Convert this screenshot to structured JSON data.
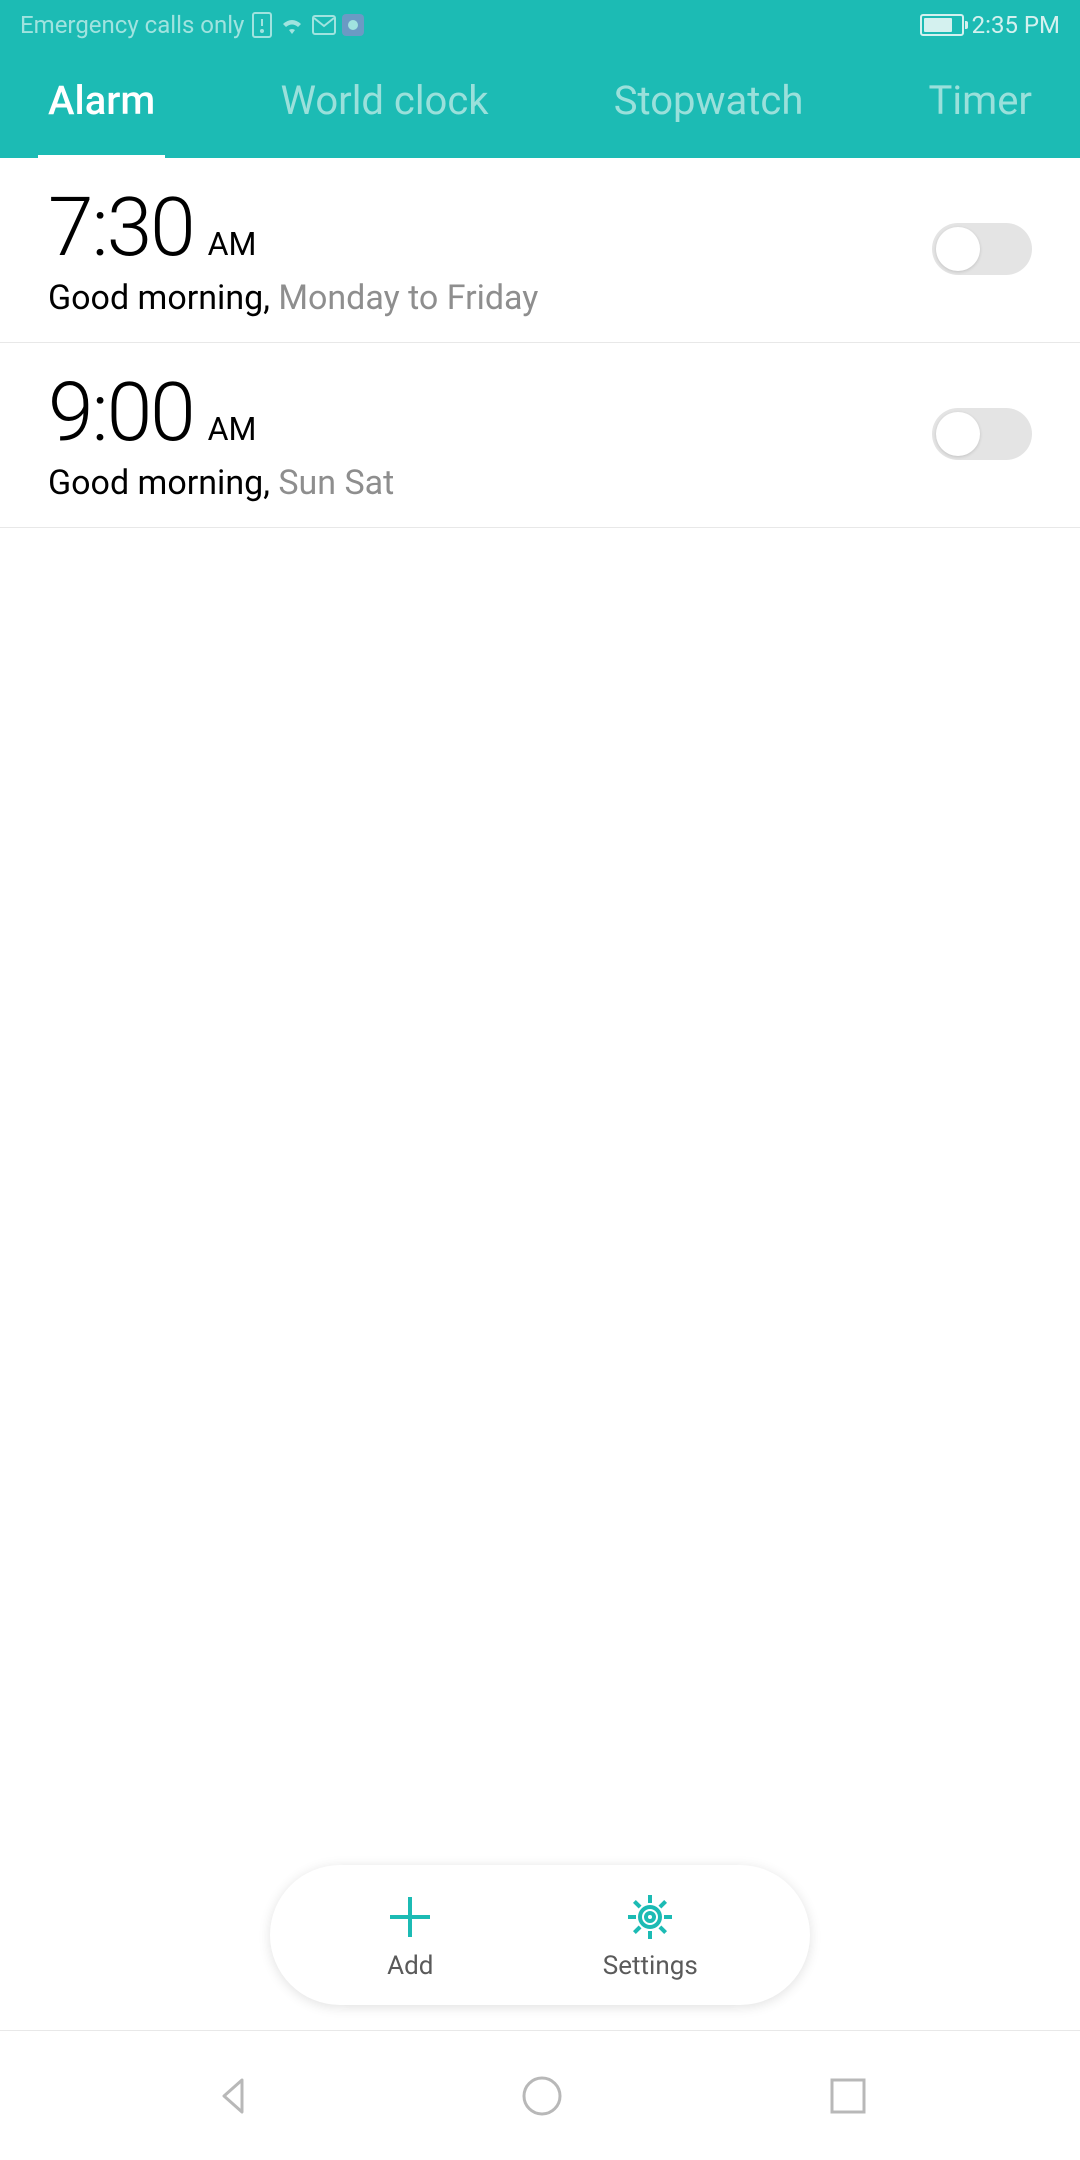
{
  "status_bar": {
    "network_text": "Emergency calls only",
    "time": "2:35 PM"
  },
  "tabs": [
    {
      "label": "Alarm",
      "active": true
    },
    {
      "label": "World clock",
      "active": false
    },
    {
      "label": "Stopwatch",
      "active": false
    },
    {
      "label": "Timer",
      "active": false
    }
  ],
  "alarms": [
    {
      "time": "7:30",
      "ampm": "AM",
      "label": "Good morning,",
      "days": "Monday to Friday",
      "enabled": false
    },
    {
      "time": "9:00",
      "ampm": "AM",
      "label": "Good morning,",
      "days": "Sun Sat",
      "enabled": false
    }
  ],
  "actions": {
    "add_label": "Add",
    "settings_label": "Settings"
  }
}
